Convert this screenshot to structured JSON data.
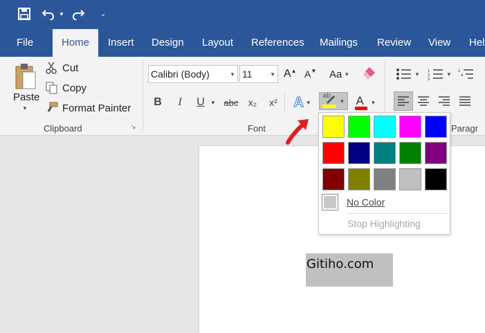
{
  "title_bar": {
    "quick_access": [
      {
        "icon": "save-icon",
        "glyph": "💾"
      },
      {
        "icon": "undo-icon",
        "glyph": "↶"
      },
      {
        "icon": "redo-icon",
        "glyph": "↷"
      },
      {
        "icon": "customize-icon",
        "glyph": "⌄"
      }
    ]
  },
  "tabs": [
    "File",
    "Home",
    "Insert",
    "Design",
    "Layout",
    "References",
    "Mailings",
    "Review",
    "View",
    "Help"
  ],
  "active_tab": "Home",
  "clipboard": {
    "paste_label": "Paste",
    "cut_label": "Cut",
    "copy_label": "Copy",
    "format_painter_label": "Format Painter",
    "group_label": "Clipboard"
  },
  "font": {
    "font_name": "Calibri (Body)",
    "font_size": "11",
    "grow_label": "A",
    "shrink_label": "A",
    "case_label": "Aa",
    "bold_label": "B",
    "italic_label": "I",
    "underline_label": "U",
    "strike_label": "abc",
    "subscript_label": "x₂",
    "superscript_label": "x²",
    "effects_label": "A",
    "highlight_label": "ab",
    "font_color_label": "A",
    "group_label": "Font"
  },
  "paragraph": {
    "group_label": "Paragr"
  },
  "highlight_palette": {
    "colors": [
      "#ffff00",
      "#00ff00",
      "#00ffff",
      "#ff00ff",
      "#0000ff",
      "#ff0000",
      "#000080",
      "#008080",
      "#008000",
      "#800080",
      "#800000",
      "#808000",
      "#808080",
      "#c0c0c0",
      "#000000"
    ],
    "no_color_label": "No Color",
    "stop_label": "Stop Highlighting"
  },
  "accent_colors": {
    "ribbon_blue": "#2b579a",
    "highlight_yellow": "#ffff00",
    "font_red": "#ff0000",
    "pointer_arrow": "#e02020"
  },
  "document": {
    "text": "Gitiho.com"
  }
}
